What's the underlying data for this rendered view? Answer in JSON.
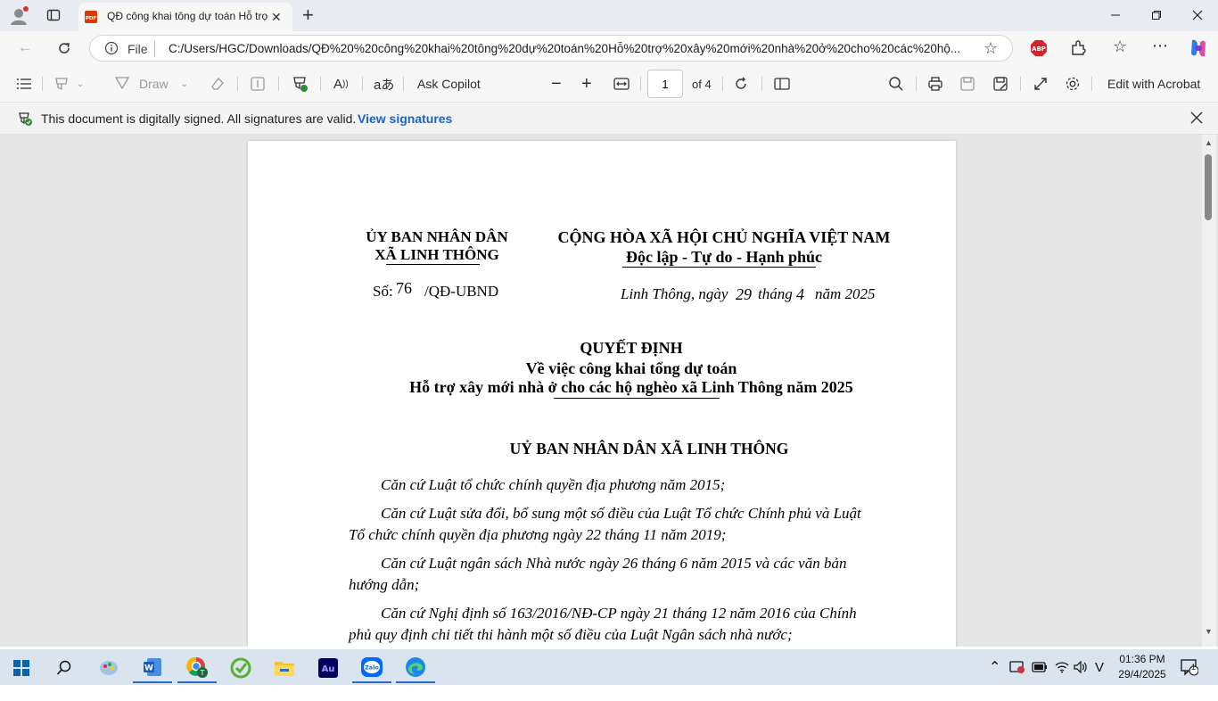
{
  "browser": {
    "tab_title": "QĐ công khai tông dự toán Hỗ trợ",
    "address": "C:/Users/HGC/Downloads/QĐ%20%20công%20khai%20tông%20dự%20toán%20Hỗ%20trợ%20xây%20mới%20nhà%20ở%20cho%20các%20hộ...",
    "address_prefix": "File"
  },
  "pdf_toolbar": {
    "draw_label": "Draw",
    "ask_copilot": "Ask Copilot",
    "page_value": "1",
    "page_total": "of 4",
    "edit_acrobat": "Edit with Acrobat"
  },
  "signature_bar": {
    "message": "This document is digitally signed. All signatures are valid.",
    "link": "View signatures"
  },
  "document": {
    "org_line1": "ỦY BAN NHÂN DÂN",
    "org_line2": "XÃ LINH THÔNG",
    "nation_line1": "CỘNG HÒA XÃ HỘI CHỦ NGHĨA VIỆT NAM",
    "nation_line2": "Độc lập - Tự do - Hạnh phúc",
    "so_label": "Số:",
    "so_number": "76",
    "so_suffix": "/QĐ-UBND",
    "date_place": "Linh Thông, ngày",
    "date_day": "29",
    "date_month_label": "tháng",
    "date_month": "4",
    "date_year": "năm 2025",
    "title": "QUYẾT ĐỊNH",
    "subtitle1": "Về việc công khai tổng dự toán",
    "subtitle2": "Hỗ trợ xây mới nhà ở cho các hộ nghèo xã Linh Thông năm 2025",
    "authority": "UỶ BAN NHÂN DÂN XÃ LINH THÔNG",
    "basis": [
      "Căn cứ Luật tổ chức chính quyền địa phương năm 2015;",
      "Căn cứ Luật sửa đổi, bổ sung một số điều của Luật Tổ chức Chính phủ và Luật",
      "Tổ chức chính quyền địa phương ngày 22 tháng 11 năm 2019;",
      "Căn cứ Luật ngân sách Nhà nước ngày 26 tháng 6 năm 2015 và các văn bản",
      "hướng dẫn;",
      "Căn cứ Nghị định số 163/2016/NĐ-CP ngày 21 tháng 12 năm 2016 của Chính",
      "phủ quy định chi tiết thi hành một số điều của Luật Ngân sách nhà nước;"
    ]
  },
  "taskbar": {
    "time": "01:36 PM",
    "date": "29/4/2025",
    "notif_count": "1"
  }
}
